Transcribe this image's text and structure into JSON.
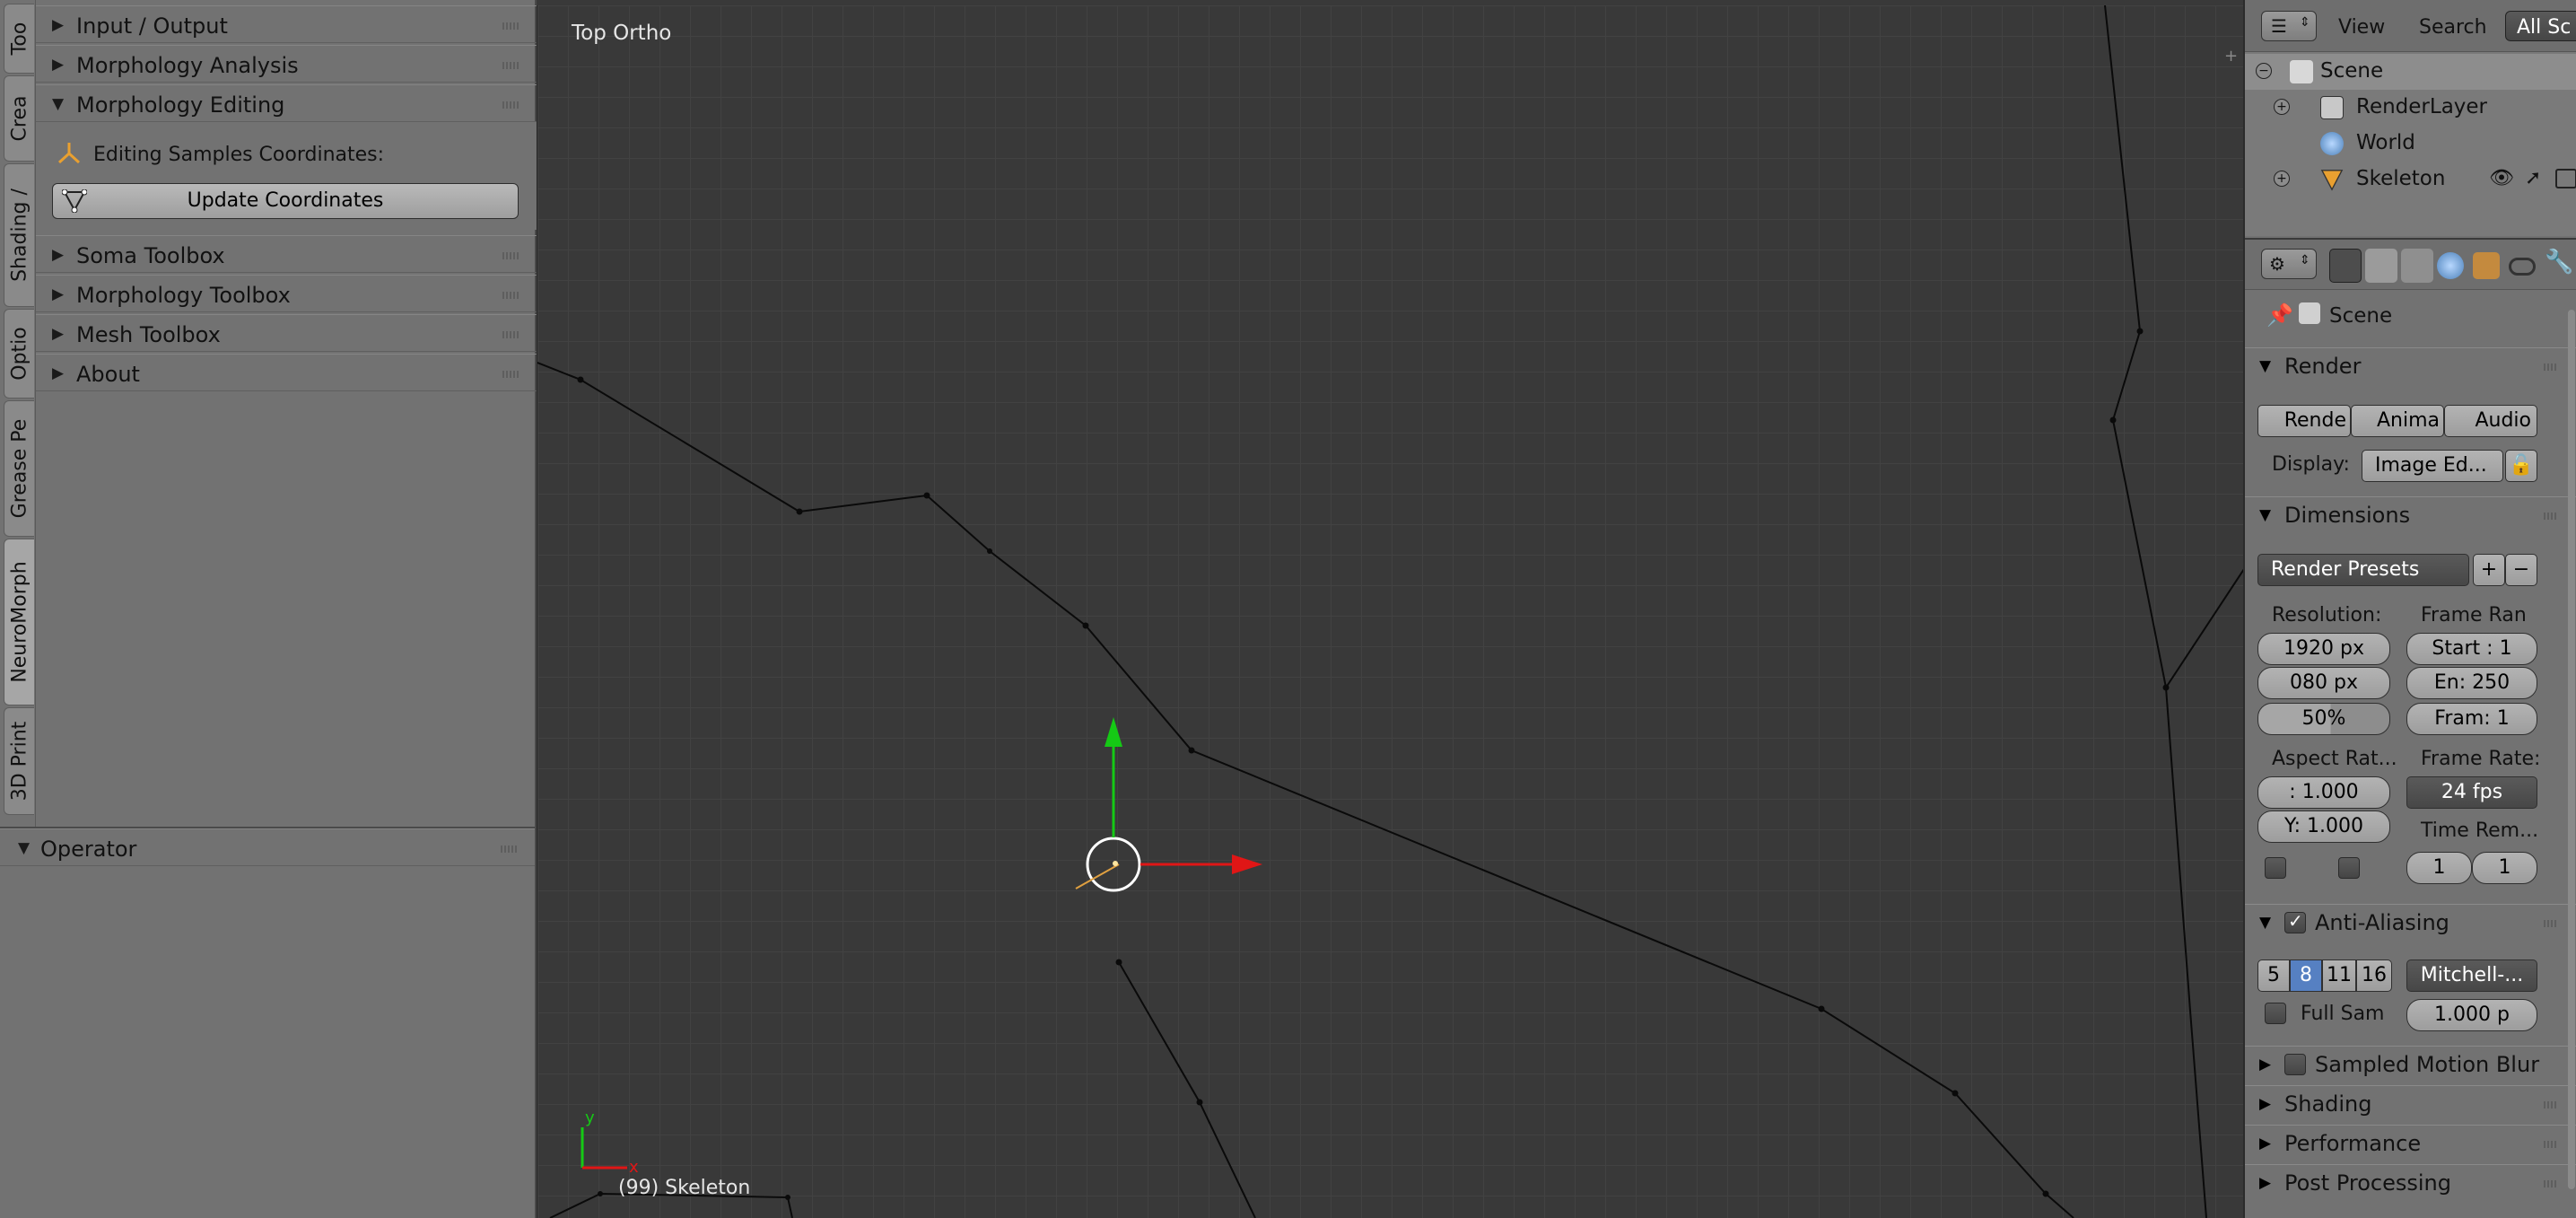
{
  "toolshelf": {
    "tabs": [
      "Too",
      "Crea",
      "Shading /",
      "Optio",
      "Grease Pe",
      "NeuroMorph",
      "3D Print"
    ],
    "panels": {
      "input_output": "Input / Output",
      "morphology_analysis": "Morphology Analysis",
      "morphology_editing": "Morphology Editing",
      "editing_samples_label": "Editing Samples Coordinates:",
      "update_coordinates": "Update Coordinates",
      "soma_toolbox": "Soma Toolbox",
      "morphology_toolbox": "Morphology Toolbox",
      "mesh_toolbox": "Mesh Toolbox",
      "about": "About"
    },
    "operator": "Operator"
  },
  "viewport": {
    "title": "Top Ortho",
    "object_label": "(99) Skeleton",
    "axis_x": "x",
    "axis_y": "y"
  },
  "outliner": {
    "header": {
      "view": "View",
      "search": "Search",
      "filter": "All Sc"
    },
    "items": [
      "Scene",
      "RenderLayer",
      "World",
      "Skeleton"
    ]
  },
  "properties": {
    "context": "Scene",
    "render": {
      "title": "Render",
      "buttons": [
        "Rende",
        "Anima",
        "Audio"
      ],
      "display_label": "Display:",
      "display_value": "Image Ed..."
    },
    "dimensions": {
      "title": "Dimensions",
      "presets": "Render Presets",
      "resolution_label": "Resolution:",
      "res_x": "1920 px",
      "res_y": "080 px",
      "res_pct": "50%",
      "frame_range_label": "Frame Ran",
      "start": "Start : 1",
      "end": "En: 250",
      "frame": "Fram: 1",
      "aspect_label": "Aspect Rat...",
      "aspect_x": ":  1.000",
      "aspect_y": "Y: 1.000",
      "frame_rate_label": "Frame Rate:",
      "frame_rate": "24 fps",
      "time_remap_label": "Time Rem...",
      "time_old": "1",
      "time_new": "1"
    },
    "anti_aliasing": {
      "title": "Anti-Aliasing",
      "samples": [
        "5",
        "8",
        "11",
        "16"
      ],
      "selected": "8",
      "filter": "Mitchell-...",
      "full_sample": "Full Sam",
      "filter_size": "1.000 p"
    },
    "collapsed_panels": [
      "Sampled Motion Blur",
      "Shading",
      "Performance",
      "Post Processing"
    ]
  },
  "colors": {
    "axis_x": "#e01616",
    "axis_y": "#15c915",
    "active_sample": "#5680c2"
  }
}
